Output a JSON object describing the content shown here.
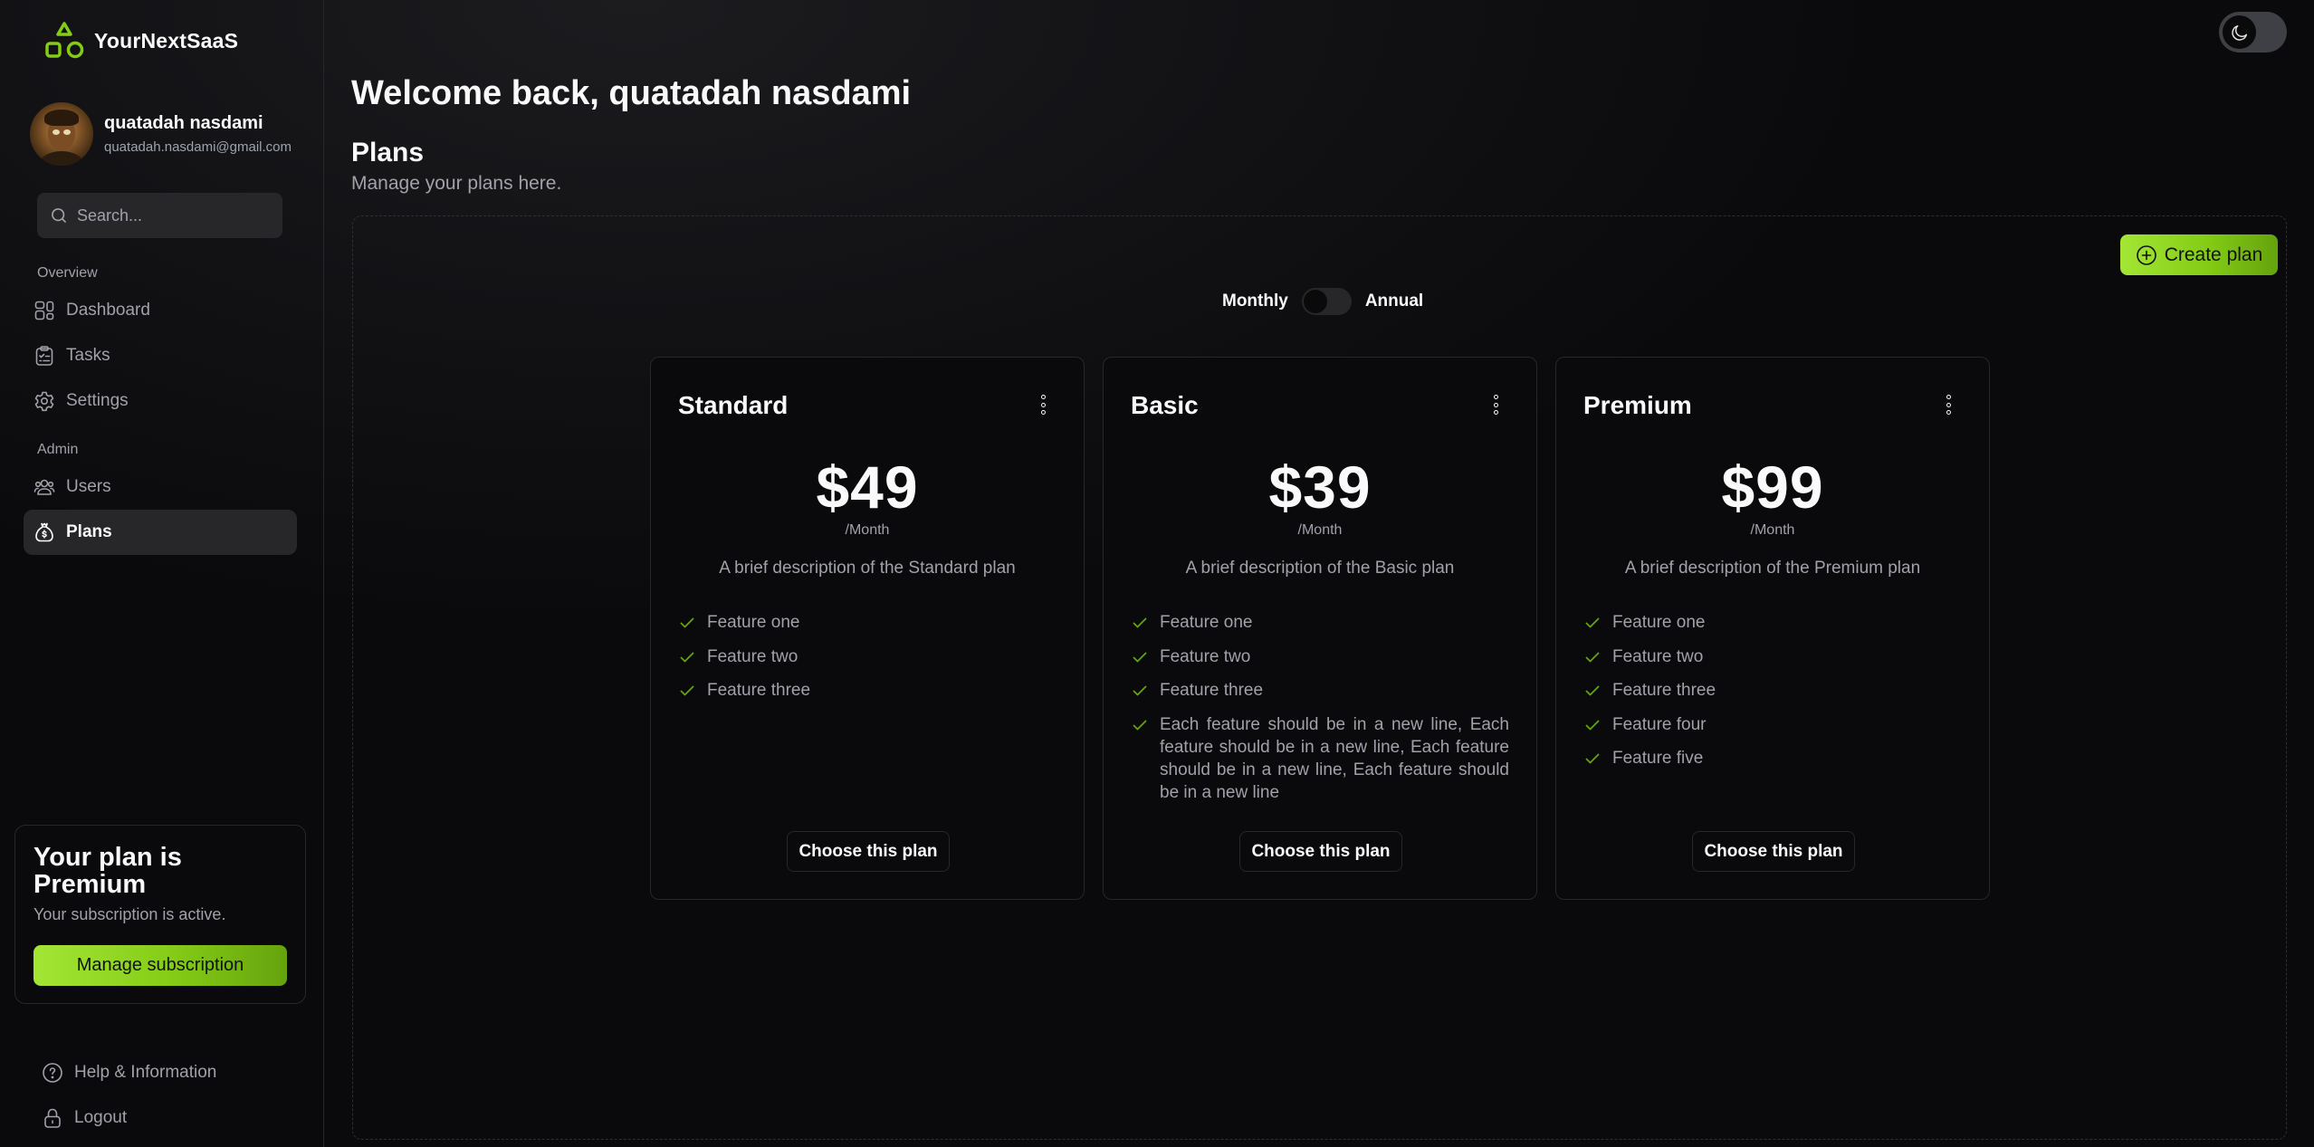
{
  "app": {
    "name": "YourNextSaaS",
    "accent_color": "#84cc16"
  },
  "user": {
    "name": "quatadah nasdami",
    "email": "quatadah.nasdami@gmail.com"
  },
  "sidebar": {
    "search_placeholder": "Search...",
    "sections": [
      {
        "label": "Overview",
        "items": [
          {
            "label": "Dashboard",
            "icon": "dashboard-icon",
            "active": false
          },
          {
            "label": "Tasks",
            "icon": "clipboard-icon",
            "active": false
          },
          {
            "label": "Settings",
            "icon": "gear-icon",
            "active": false
          }
        ]
      },
      {
        "label": "Admin",
        "items": [
          {
            "label": "Users",
            "icon": "users-icon",
            "active": false
          },
          {
            "label": "Plans",
            "icon": "money-bag-icon",
            "active": true
          }
        ]
      }
    ],
    "plan_card": {
      "title": "Your plan is Premium",
      "subtitle": "Your subscription is active.",
      "button_label": "Manage subscription"
    },
    "bottom_items": [
      {
        "label": "Help & Information",
        "icon": "help-circle-icon"
      },
      {
        "label": "Logout",
        "icon": "lock-icon"
      }
    ]
  },
  "header": {
    "theme_toggle": {
      "mode": "dark",
      "icon": "moon-icon"
    }
  },
  "main": {
    "welcome": "Welcome back, quatadah nasdami",
    "title": "Plans",
    "subtitle": "Manage your plans here.",
    "create_button_label": "Create plan",
    "billing": {
      "left_label": "Monthly",
      "right_label": "Annual",
      "selected": "Monthly"
    },
    "plans": [
      {
        "name": "Standard",
        "price": "$49",
        "period": "/Month",
        "description": "A brief description of the Standard plan",
        "features": [
          "Feature one",
          "Feature two",
          "Feature three"
        ],
        "button_label": "Choose this plan"
      },
      {
        "name": "Basic",
        "price": "$39",
        "period": "/Month",
        "description": "A brief description of the Basic plan",
        "features": [
          "Feature one",
          "Feature two",
          "Feature three",
          "Each feature should be in a new line, Each feature should be in a new line, Each feature should be in a new line, Each feature should be in a new line"
        ],
        "button_label": "Choose this plan"
      },
      {
        "name": "Premium",
        "price": "$99",
        "period": "/Month",
        "description": "A brief description of the Premium plan",
        "features": [
          "Feature one",
          "Feature two",
          "Feature three",
          "Feature four",
          "Feature five"
        ],
        "button_label": "Choose this plan"
      }
    ]
  }
}
